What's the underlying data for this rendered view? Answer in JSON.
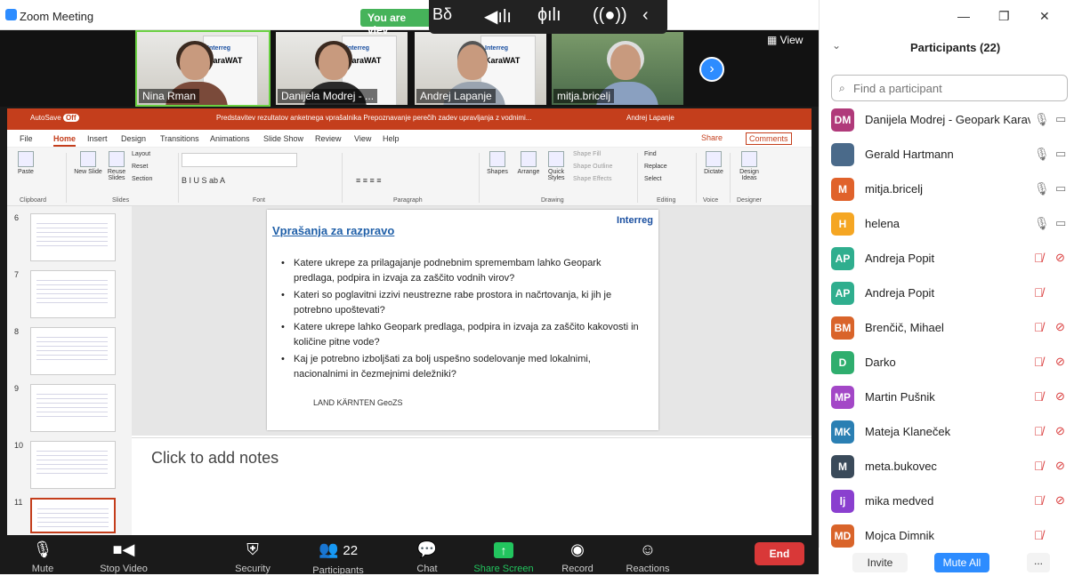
{
  "window": {
    "title": "Zoom Meeting"
  },
  "viewing": {
    "label": "You are viev"
  },
  "strip": {
    "thumbs": [
      {
        "name": "Nina Rman",
        "poster_top": "Interreg",
        "poster_title": "KaraWAT"
      },
      {
        "name": "Danijela Modrej - ...",
        "poster_top": "Interreg",
        "poster_title": "KaraWAT"
      },
      {
        "name": "Andrej Lapanje",
        "poster_top": "Interreg",
        "poster_title": "KaraWAT"
      },
      {
        "name": "mitja.bricelj"
      }
    ],
    "view_label": "View"
  },
  "ppt": {
    "autosave": "AutoSave",
    "autosave_state": "Off",
    "doc_title": "Predstavitev rezultatov anketnega vprašalnika Prepoznavanje perečih zadev upravljanja z vodnimi...",
    "user": "Andrej Lapanje",
    "menu": [
      "File",
      "Home",
      "Insert",
      "Design",
      "Transitions",
      "Animations",
      "Slide Show",
      "Review",
      "View",
      "Help"
    ],
    "share": "Share",
    "comments": "Comments",
    "ribbon": {
      "paste": "Paste",
      "new_slide": "New Slide",
      "reuse": "Reuse Slides",
      "layout": "Layout",
      "reset": "Reset",
      "section": "Section",
      "shapes": "Shapes",
      "arrange": "Arrange",
      "quick_styles": "Quick Styles",
      "shape_fill": "Shape Fill",
      "shape_outline": "Shape Outline",
      "shape_effects": "Shape Effects",
      "find": "Find",
      "replace": "Replace",
      "select": "Select",
      "dictate": "Dictate",
      "design_ideas": "Design Ideas",
      "groups": [
        "Clipboard",
        "Slides",
        "Font",
        "Paragraph",
        "Drawing",
        "Editing",
        "Voice",
        "Designer"
      ]
    },
    "slide_numbers": [
      "6",
      "7",
      "8",
      "9",
      "10",
      "11"
    ],
    "slide": {
      "title": "Vprašanja za razpravo",
      "logo": "Interreg",
      "bullets": [
        "Katere ukrepe za prilagajanje podnebnim spremembam lahko Geopark predlaga, podpira in izvaja za zaščito vodnih virov?",
        "Kateri so poglavitni izzivi neustrezne rabe prostora in načrtovanja, ki jih je potrebno upoštevati?",
        "Katere ukrepe lahko Geopark predlaga, podpira in izvaja za zaščito kakovosti in količine pitne vode?",
        "Kaj je potrebno izboljšati za bolj uspešno sodelovanje med lokalnimi, nacionalnimi in čezmejnimi deležniki?"
      ],
      "footer": "LAND KÄRNTEN   GeoZS"
    },
    "notes_placeholder": "Click to add notes"
  },
  "controls": {
    "mute": "Mute",
    "stop_video": "Stop Video",
    "security": "Security",
    "participants": "Participants",
    "participants_count": "22",
    "chat": "Chat",
    "share_screen": "Share Screen",
    "record": "Record",
    "reactions": "Reactions",
    "end": "End"
  },
  "panel": {
    "title": "Participants (22)",
    "search_placeholder": "Find a participant",
    "invite": "Invite",
    "mute_all": "Mute All",
    "more": "...",
    "participants": [
      {
        "initials": "DM",
        "name": "Danijela Modrej - Geopark Karav...",
        "color": "#b03a7a",
        "mic": "on",
        "cam": "off"
      },
      {
        "initials": "",
        "name": "Gerald Hartmann",
        "color": "#4a6a8a",
        "mic": "on",
        "cam": "off"
      },
      {
        "initials": "M",
        "name": "mitja.bricelj",
        "color": "#e0622b",
        "mic": "on",
        "cam": "off"
      },
      {
        "initials": "H",
        "name": "helena",
        "color": "#f5a623",
        "mic": "on",
        "cam": "off"
      },
      {
        "initials": "AP",
        "name": "Andreja Popit",
        "color": "#2fae8e",
        "mic": "muted",
        "cam": "muted"
      },
      {
        "initials": "AP",
        "name": "Andreja Popit",
        "color": "#2fae8e",
        "mic": "muted",
        "cam": "none"
      },
      {
        "initials": "BM",
        "name": "Brenčič, Mihael",
        "color": "#d9642a",
        "mic": "muted",
        "cam": "muted"
      },
      {
        "initials": "D",
        "name": "Darko",
        "color": "#2fae6e",
        "mic": "muted",
        "cam": "muted"
      },
      {
        "initials": "MP",
        "name": "Martin Pušnik",
        "color": "#a347c7",
        "mic": "muted",
        "cam": "muted"
      },
      {
        "initials": "MK",
        "name": "Mateja Klaneček",
        "color": "#2a7fb3",
        "mic": "muted",
        "cam": "muted"
      },
      {
        "initials": "M",
        "name": "meta.bukovec",
        "color": "#3a4a5a",
        "mic": "muted",
        "cam": "muted"
      },
      {
        "initials": "lj",
        "name": "mika medved",
        "color": "#8a3fcf",
        "mic": "muted",
        "cam": "muted"
      },
      {
        "initials": "MD",
        "name": "Mojca Dimnik",
        "color": "#d9642a",
        "mic": "muted",
        "cam": "none"
      }
    ]
  }
}
